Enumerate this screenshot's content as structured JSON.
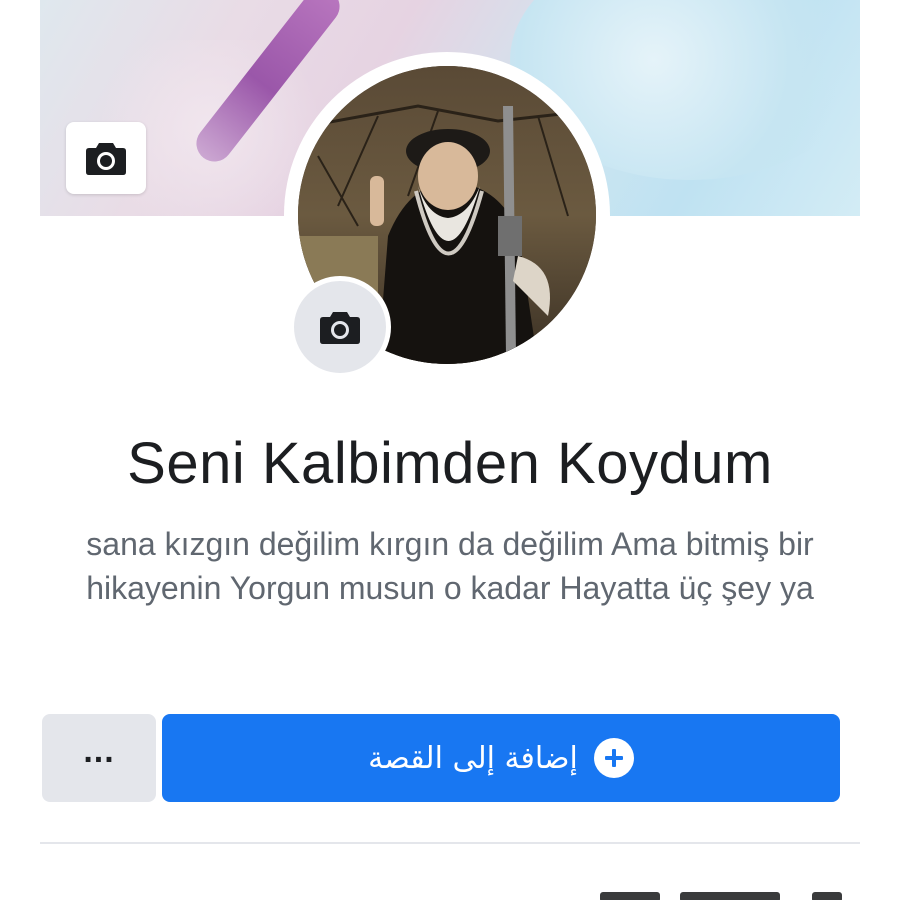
{
  "profile": {
    "name": "Seni Kalbimden Koydum",
    "bio": "sana kızgın değilim kırgın da değilim Ama bitmiş bir hikayenin Yorgun musun o kadar Hayatta üç şey ya"
  },
  "actions": {
    "add_story_label": "إضافة إلى القصة",
    "more_label": "..."
  },
  "icons": {
    "cover_camera": "camera-icon",
    "avatar_camera": "camera-icon",
    "add_story": "plus-circle-icon"
  },
  "colors": {
    "primary_button": "#1877f2",
    "secondary_button": "#e4e6eb",
    "name_text": "#1c1e21",
    "bio_text": "#606770"
  }
}
